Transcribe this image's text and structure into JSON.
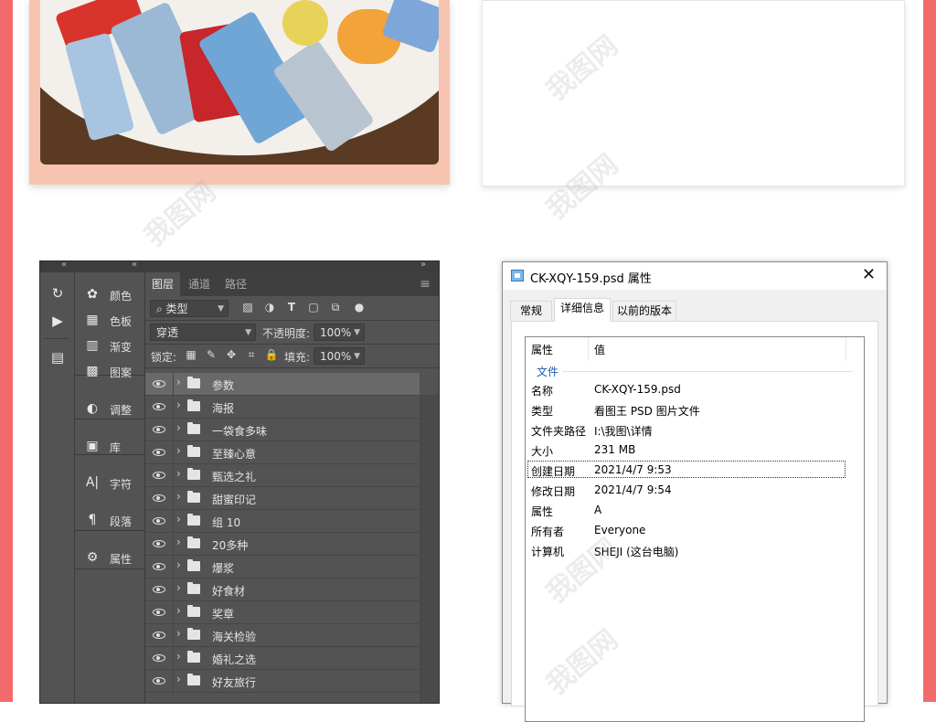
{
  "colors": {
    "accent_bar": "#f26a6a",
    "ps_bg": "#535353",
    "ps_dark": "#3f3f3f",
    "link_blue": "#1e5aa8"
  },
  "watermark": "我图网",
  "photoshop": {
    "col1_icons": [
      "history-icon",
      "play-icon",
      "notes-icon"
    ],
    "col2_items": [
      {
        "icon": "palette-icon",
        "glyph": "🎨",
        "label": "颜色"
      },
      {
        "icon": "swatches-icon",
        "glyph": "▦",
        "label": "色板"
      },
      {
        "icon": "gradient-icon",
        "glyph": "▥",
        "label": "渐变"
      },
      {
        "icon": "pattern-icon",
        "glyph": "▩",
        "label": "图案"
      },
      {
        "icon": "adjust-icon",
        "glyph": "◐",
        "label": "调整"
      },
      {
        "icon": "library-icon",
        "glyph": "▣",
        "label": "库"
      },
      {
        "icon": "character-icon",
        "glyph": "A|",
        "label": "字符"
      },
      {
        "icon": "paragraph-icon",
        "glyph": "¶",
        "label": "段落"
      },
      {
        "icon": "properties-icon",
        "glyph": "⚙",
        "label": "属性"
      }
    ],
    "tabs": [
      "图层",
      "通道",
      "路径"
    ],
    "filter_label": "类型",
    "blend_mode": "穿透",
    "opacity_label": "不透明度:",
    "opacity_value": "100%",
    "lock_label": "锁定:",
    "fill_label": "填充:",
    "fill_value": "100%",
    "layers": [
      "参数",
      "海报",
      "一袋食多味",
      "至臻心意",
      "甄选之礼",
      "甜蜜印记",
      "组 10",
      "20多种",
      "爆浆",
      "好食材",
      "奖章",
      "海关检验",
      "婚礼之选",
      "好友旅行"
    ]
  },
  "properties_dialog": {
    "title": "CK-XQY-159.psd 属性",
    "tabs": [
      "常规",
      "详细信息",
      "以前的版本"
    ],
    "header_property": "属性",
    "header_value": "值",
    "group": "文件",
    "rows": [
      {
        "key": "名称",
        "value": "CK-XQY-159.psd"
      },
      {
        "key": "类型",
        "value": "看图王 PSD 图片文件"
      },
      {
        "key": "文件夹路径",
        "value": "I:\\我图\\详情"
      },
      {
        "key": "大小",
        "value": "231 MB"
      },
      {
        "key": "创建日期",
        "value": "2021/4/7 9:53"
      },
      {
        "key": "修改日期",
        "value": "2021/4/7 9:54"
      },
      {
        "key": "属性",
        "value": "A"
      },
      {
        "key": "所有者",
        "value": "Everyone"
      },
      {
        "key": "计算机",
        "value": "SHEJI (这台电脑)"
      }
    ]
  }
}
